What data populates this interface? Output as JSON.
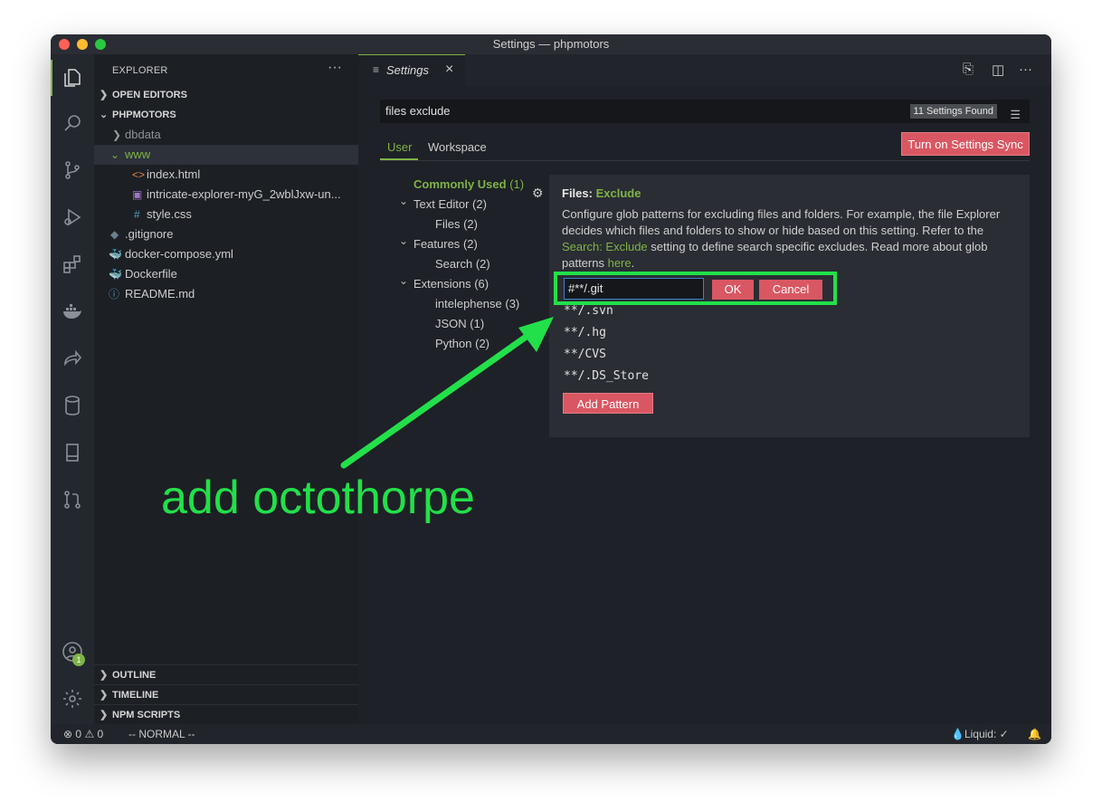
{
  "window": {
    "title": "Settings — phpmotors"
  },
  "sidebar": {
    "header": "EXPLORER",
    "more": "···",
    "open_editors": "OPEN EDITORS",
    "project": "PHPMOTORS",
    "items": [
      {
        "label": "dbdata",
        "icon": "chevron-right"
      },
      {
        "label": "www",
        "icon": "chevron-down"
      },
      {
        "label": "index.html",
        "icon": "<>"
      },
      {
        "label": "intricate-explorer-myG_2wblJxw-un...",
        "icon": "image"
      },
      {
        "label": "style.css",
        "icon": "#"
      },
      {
        "label": ".gitignore",
        "icon": "diamond"
      },
      {
        "label": "docker-compose.yml",
        "icon": "docker"
      },
      {
        "label": "Dockerfile",
        "icon": "docker"
      },
      {
        "label": "README.md",
        "icon": "ⓘ"
      }
    ],
    "outline": "OUTLINE",
    "timeline": "TIMELINE",
    "npm_scripts": "NPM SCRIPTS"
  },
  "activity": {
    "badge": "1"
  },
  "tab": {
    "label": "Settings",
    "close": "×"
  },
  "settings": {
    "search_value": "files exclude",
    "found": "11 Settings Found",
    "scopes": [
      "User",
      "Workspace"
    ],
    "sync_button": "Turn on Settings Sync",
    "toc": [
      {
        "label": "Commonly Used",
        "count": "(1)"
      },
      {
        "label": "Text Editor",
        "count": "(2)"
      },
      {
        "label": "Files",
        "count": "(2)"
      },
      {
        "label": "Features",
        "count": "(2)"
      },
      {
        "label": "Search",
        "count": "(2)"
      },
      {
        "label": "Extensions",
        "count": "(6)"
      },
      {
        "label": "intelephense",
        "count": "(3)"
      },
      {
        "label": "JSON",
        "count": "(1)"
      },
      {
        "label": "Python",
        "count": "(2)"
      }
    ],
    "title_prefix": "Files: ",
    "title_name": "Exclude",
    "desc_1": "Configure glob patterns for excluding files and folders. For example, the file Explorer decides which files and folders to show or hide based on this setting. Refer to the ",
    "desc_link1": "Search: Exclude",
    "desc_2": " setting to define search specific excludes. Read more about glob patterns ",
    "desc_link2": "here",
    "desc_3": ".",
    "edit_value": "#**/.git",
    "ok": "OK",
    "cancel": "Cancel",
    "patterns": [
      "**/.svn",
      "**/.hg",
      "**/CVS",
      "**/.DS_Store"
    ],
    "add_pattern": "Add Pattern"
  },
  "status": {
    "errors": "0",
    "warnings": "0",
    "mode": "-- NORMAL --",
    "liquid": "💧Liquid: ✓"
  },
  "annotation": {
    "text": "add octothorpe",
    "color": "#22e04a"
  }
}
